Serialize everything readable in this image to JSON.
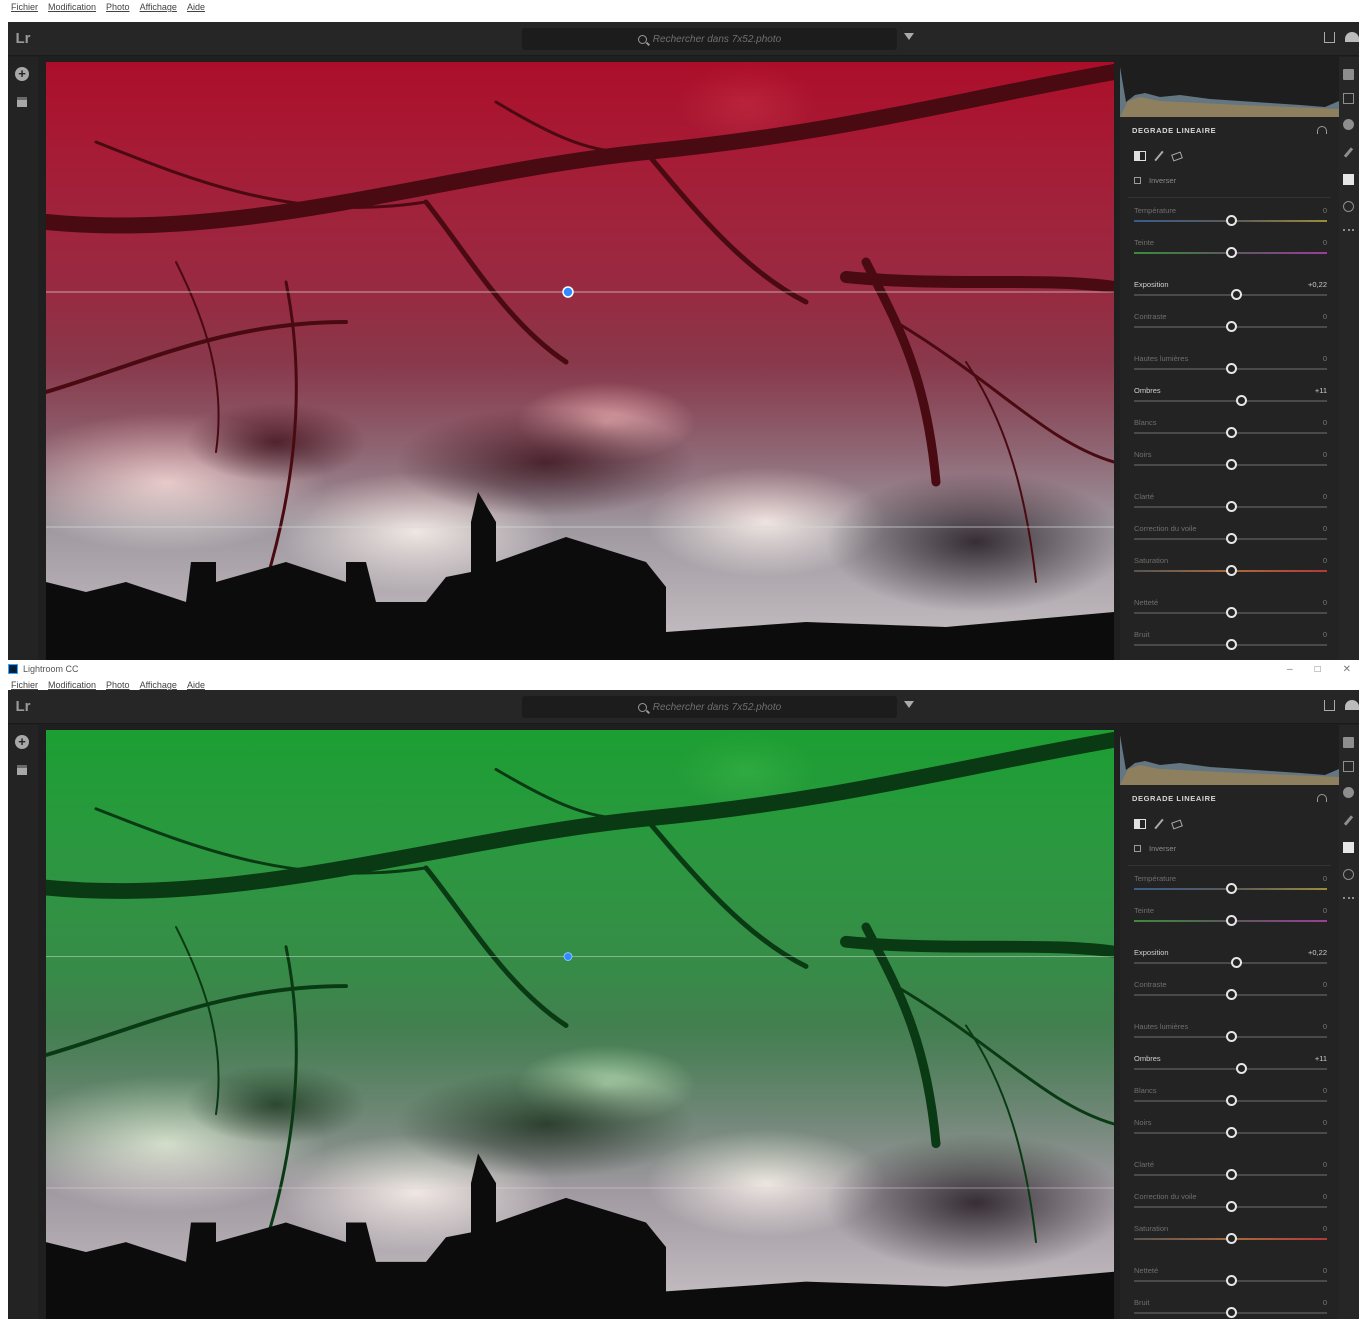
{
  "app_window_title": "Lightroom CC",
  "window_controls": [
    "–",
    "□",
    "✕"
  ],
  "menu": [
    "Fichier",
    "Modification",
    "Photo",
    "Affichage",
    "Aide"
  ],
  "toolbar": {
    "logo": "Lr",
    "search_placeholder": "Rechercher dans 7x52.photo"
  },
  "panel": {
    "section_title": "DEGRADE LINEAIRE",
    "invert_label": "Inverser",
    "sliders": [
      {
        "label": "Température",
        "value": "0",
        "level": 0.5,
        "active": false,
        "track": "temp",
        "gap": false
      },
      {
        "label": "Teinte",
        "value": "0",
        "level": 0.5,
        "active": false,
        "track": "tint",
        "gap": false
      },
      {
        "label": "Exposition",
        "value": "+0,22",
        "level": 0.53,
        "active": true,
        "track": "",
        "gap": true
      },
      {
        "label": "Contraste",
        "value": "0",
        "level": 0.5,
        "active": false,
        "track": "",
        "gap": false
      },
      {
        "label": "Hautes lumières",
        "value": "0",
        "level": 0.5,
        "active": false,
        "track": "",
        "gap": true
      },
      {
        "label": "Ombres",
        "value": "+11",
        "level": 0.555,
        "active": true,
        "track": "",
        "gap": false
      },
      {
        "label": "Blancs",
        "value": "0",
        "level": 0.5,
        "active": false,
        "track": "",
        "gap": false
      },
      {
        "label": "Noirs",
        "value": "0",
        "level": 0.5,
        "active": false,
        "track": "",
        "gap": false
      },
      {
        "label": "Clarté",
        "value": "0",
        "level": 0.5,
        "active": false,
        "track": "",
        "gap": true
      },
      {
        "label": "Correction du voile",
        "value": "0",
        "level": 0.5,
        "active": false,
        "track": "",
        "gap": false
      },
      {
        "label": "Saturation",
        "value": "0",
        "level": 0.5,
        "active": false,
        "track": "sat",
        "gap": false
      },
      {
        "label": "Netteté",
        "value": "0",
        "level": 0.5,
        "active": false,
        "track": "",
        "gap": true
      },
      {
        "label": "Bruit",
        "value": "0",
        "level": 0.5,
        "active": false,
        "track": "",
        "gap": false
      }
    ]
  },
  "mask_overlays": {
    "top": "#b0001c",
    "bottom": "#12a028"
  },
  "accent": "#2f8cff",
  "icons": {
    "search": "search-icon",
    "filter": "filter-icon",
    "share": "share-icon",
    "cloud": "cloud-icon",
    "add": "add-photo-icon",
    "library": "library-icon"
  }
}
